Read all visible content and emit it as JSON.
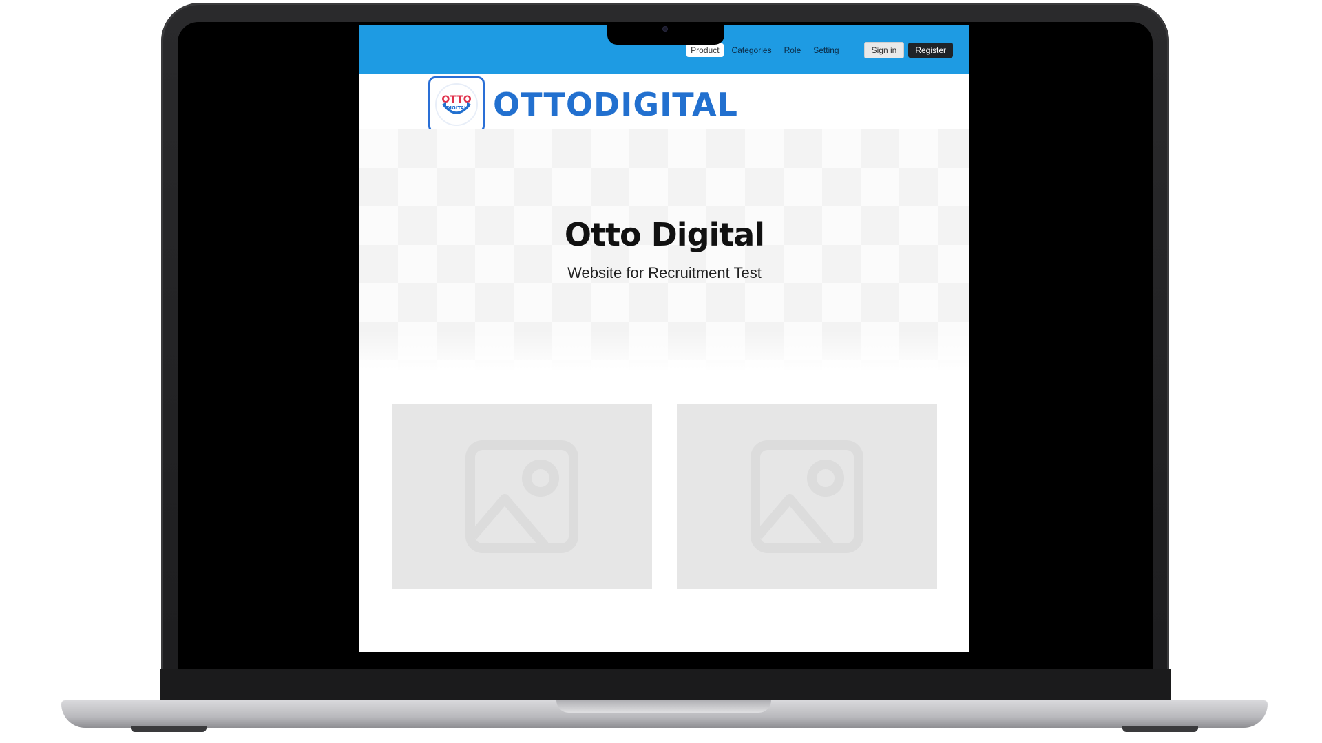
{
  "nav": {
    "items": [
      {
        "label": "Product",
        "active": true
      },
      {
        "label": "Categories",
        "active": false
      },
      {
        "label": "Role",
        "active": false
      },
      {
        "label": "Setting",
        "active": false
      }
    ],
    "signin_label": "Sign in",
    "register_label": "Register"
  },
  "logo": {
    "badge_text_top": "OTTO",
    "badge_text_bottom": "DIGITAL",
    "wordmark": "OTTODIGITAL"
  },
  "hero": {
    "title": "Otto Digital",
    "subtitle": "Website for Recruitment Test"
  },
  "gallery": {
    "items": [
      {
        "icon": "image-placeholder-icon"
      },
      {
        "icon": "image-placeholder-icon"
      }
    ]
  },
  "colors": {
    "header_blue": "#1e9be3",
    "brand_blue": "#2270cf",
    "register_bg": "#1f2328",
    "placeholder_bg": "#e6e6e6"
  }
}
